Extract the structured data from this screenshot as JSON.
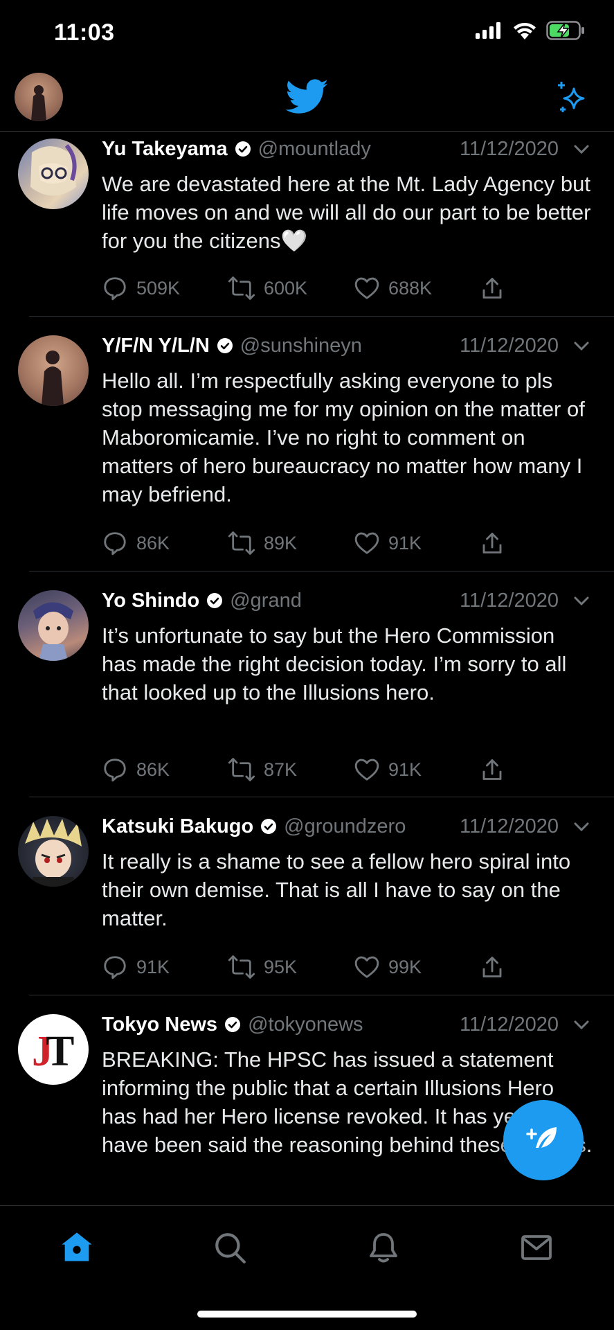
{
  "status_bar": {
    "time": "11:03"
  },
  "header": {
    "logo_icon": "twitter-bird-icon",
    "sparkle_icon": "sparkle-icon"
  },
  "tweets": [
    {
      "name": "Yu Takeyama",
      "handle": "@mountlady",
      "date": "11/12/2020",
      "text": "We are devastated here at the Mt. Lady Agency but life moves on and we will all do our part to be better for you the citizens🤍",
      "replies": "509K",
      "retweets": "600K",
      "likes": "688K"
    },
    {
      "name": "Y/F/N Y/L/N",
      "handle": "@sunshineyn",
      "date": "11/12/2020",
      "text": "Hello all. I’m respectfully asking everyone to pls stop messaging me for my opinion on the matter of Maboromicamie. I’ve no right to comment on matters of hero bureaucracy no matter how many I may befriend.",
      "replies": "86K",
      "retweets": "89K",
      "likes": "91K"
    },
    {
      "name": "Yo Shindo",
      "handle": "@grand",
      "date": "11/12/2020",
      "text": "It’s unfortunate to say but the Hero Commission has made the right decision today. I’m sorry to all that looked up to the Illusions hero.",
      "replies": "86K",
      "retweets": "87K",
      "likes": "91K"
    },
    {
      "name": "Katsuki Bakugo",
      "handle": "@groundzero",
      "date": "11/12/2020",
      "text": "It really is a shame to see a fellow hero spiral into their own demise. That is all I have to say on the matter.",
      "replies": "91K",
      "retweets": "95K",
      "likes": "99K"
    },
    {
      "name": "Tokyo News",
      "handle": "@tokyonews",
      "date": "11/12/2020",
      "text": "BREAKING: The HPSC has issued a statement informing the public that a certain Illusions Hero has had her Hero license revoked. It has yet to have been said the reasoning behind these actions.",
      "avatar_text": "JT"
    }
  ],
  "colors": {
    "accent": "#1d9bf0",
    "muted": "#71767b",
    "divider": "#2f3336"
  },
  "bottom_nav": [
    "home-icon",
    "search-icon",
    "notifications-bell-icon",
    "messages-envelope-icon"
  ]
}
